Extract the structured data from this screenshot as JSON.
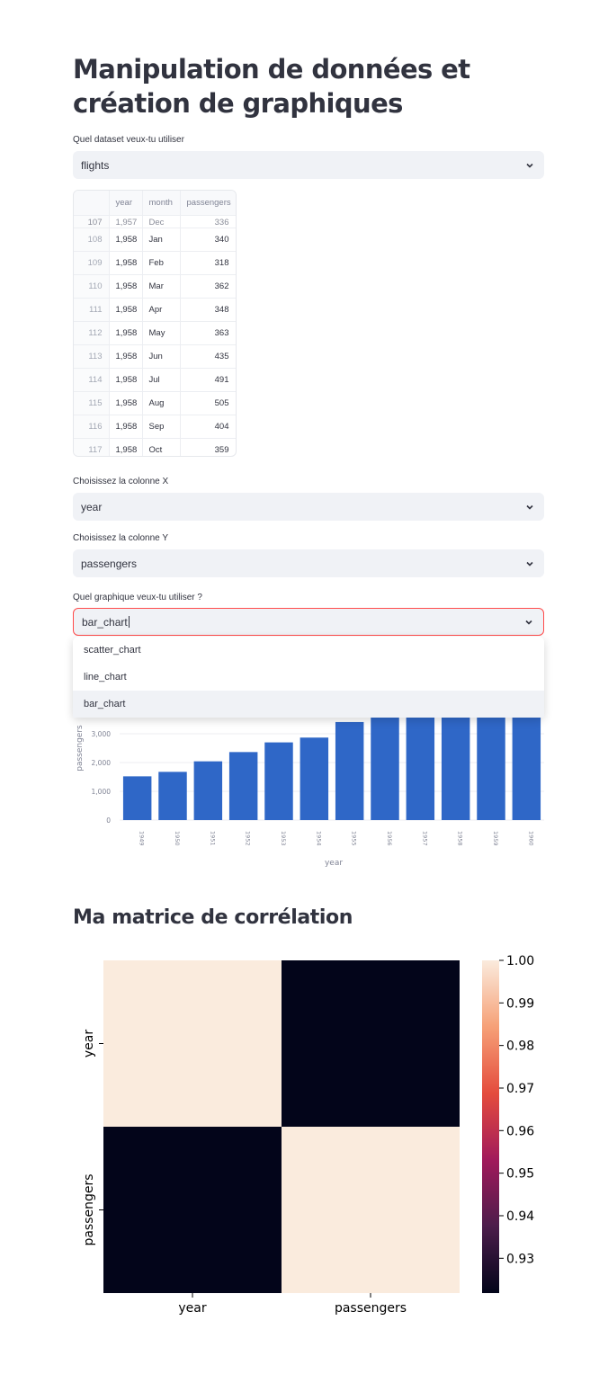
{
  "page_title": "Manipulation de données et création de graphiques",
  "dataset_select": {
    "label": "Quel dataset veux-tu utiliser",
    "value": "flights"
  },
  "dataframe": {
    "columns": [
      "",
      "year",
      "month",
      "passengers"
    ],
    "partial_row": [
      "107",
      "1,957",
      "Dec",
      "336"
    ],
    "rows": [
      [
        "108",
        "1,958",
        "Jan",
        "340"
      ],
      [
        "109",
        "1,958",
        "Feb",
        "318"
      ],
      [
        "110",
        "1,958",
        "Mar",
        "362"
      ],
      [
        "111",
        "1,958",
        "Apr",
        "348"
      ],
      [
        "112",
        "1,958",
        "May",
        "363"
      ],
      [
        "113",
        "1,958",
        "Jun",
        "435"
      ],
      [
        "114",
        "1,958",
        "Jul",
        "491"
      ],
      [
        "115",
        "1,958",
        "Aug",
        "505"
      ],
      [
        "116",
        "1,958",
        "Sep",
        "404"
      ],
      [
        "117",
        "1,958",
        "Oct",
        "359"
      ]
    ]
  },
  "x_select": {
    "label": "Choisissez la colonne X",
    "value": "year"
  },
  "y_select": {
    "label": "Choisissez la colonne Y",
    "value": "passengers"
  },
  "chart_select": {
    "label": "Quel graphique veux-tu utiliser ?",
    "value": "bar_chart",
    "options": [
      "scatter_chart",
      "line_chart",
      "bar_chart"
    ],
    "selected_index": 2
  },
  "correlation_title": "Ma matrice de corrélation",
  "chart_data": [
    {
      "type": "bar",
      "xlabel": "year",
      "ylabel": "passengers",
      "categories": [
        "1949",
        "1950",
        "1951",
        "1952",
        "1953",
        "1954",
        "1955",
        "1956",
        "1957",
        "1958",
        "1959",
        "1960"
      ],
      "values": [
        1520,
        1676,
        2042,
        2364,
        2700,
        2867,
        3408,
        3939,
        4421,
        4572,
        5140,
        5714
      ],
      "yticks": [
        "0",
        "1,000",
        "2,000",
        "3,000"
      ],
      "ylim": [
        0,
        6000
      ],
      "grid": true,
      "color": "#2f67c7"
    },
    {
      "type": "heatmap",
      "x_labels": [
        "year",
        "passengers"
      ],
      "y_labels": [
        "year",
        "passengers"
      ],
      "values": [
        [
          1.0,
          0.921824
        ],
        [
          0.921824,
          1.0
        ]
      ],
      "colorbar_ticks": [
        "1.00",
        "0.99",
        "0.98",
        "0.97",
        "0.96",
        "0.95",
        "0.94",
        "0.93"
      ],
      "colorbar_range": [
        0.921824,
        1.0
      ],
      "colormap": "rocket"
    }
  ]
}
